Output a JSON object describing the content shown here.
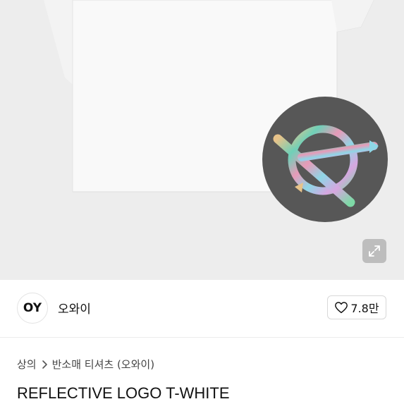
{
  "brand": {
    "logo_text": "OY",
    "name": "오와이"
  },
  "like": {
    "icon": "heart-outline-icon",
    "count": "7.8만"
  },
  "breadcrumb": {
    "category": "상의",
    "subcategory": "반소매 티셔츠 (오와이)",
    "separator_icon": "chevron-right-icon"
  },
  "product": {
    "title": "REFLECTIVE LOGO T-WHITE"
  },
  "image": {
    "expand_icon": "expand-arrows-icon",
    "background_color": "#ededed",
    "detail_circle_color": "#575757"
  }
}
